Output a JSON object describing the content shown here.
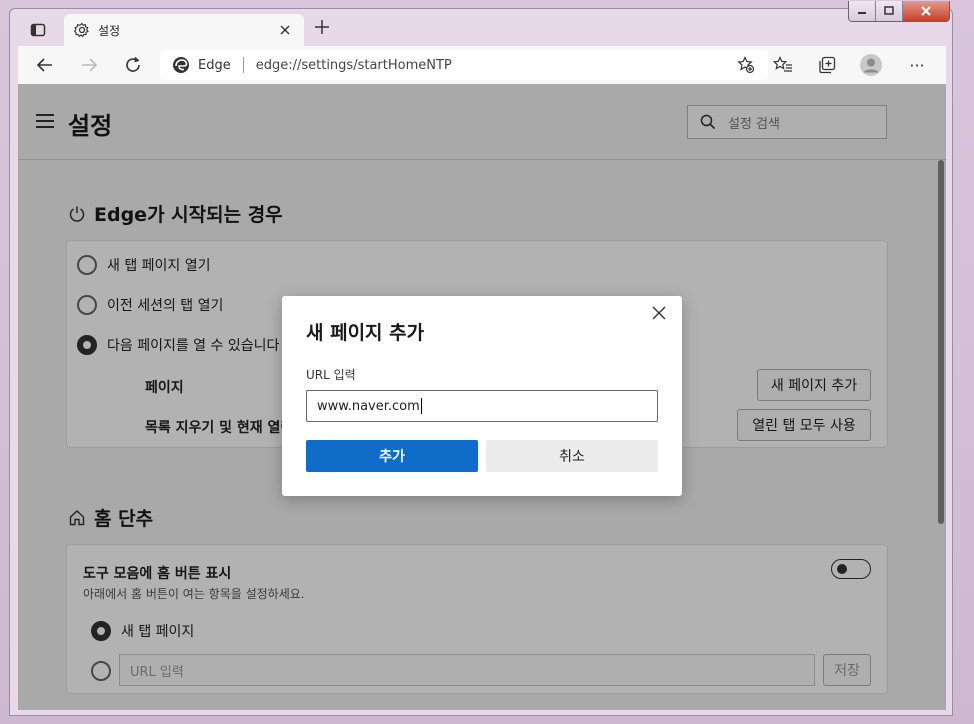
{
  "browser": {
    "tab_title": "설정",
    "address_label": "Edge",
    "address_url": "edge://settings/startHomeNTP",
    "more_label": "···"
  },
  "settings": {
    "title": "설정",
    "search_placeholder": "설정 검색",
    "startup": {
      "title": "Edge가 시작되는 경우",
      "options": [
        {
          "label": "새 탭 페이지 열기",
          "checked": false
        },
        {
          "label": "이전 세션의 탭 열기",
          "checked": false
        },
        {
          "label": "다음 페이지를 열 수 있습니다",
          "checked": true
        }
      ],
      "pages_label": "페이지",
      "add_page_button": "새 페이지 추가",
      "clear_label": "목록 지우기 및 현재 열린 탭으로 설정",
      "use_all_tabs_button": "열린 탭 모두 사용"
    },
    "home": {
      "title": "홈 단추",
      "show_button_label": "도구 모음에 홈 버튼 표시",
      "show_button_desc": "아래에서 홈 버튼이 여는 항목을 설정하세요.",
      "new_tab_option": "새 탭 페이지",
      "url_placeholder": "URL 입력",
      "save_button": "저장",
      "toggle_on": false
    }
  },
  "dialog": {
    "title": "새 페이지 추가",
    "field_label": "URL 입력",
    "field_value": "www.naver.com",
    "add_button": "추가",
    "cancel_button": "취소"
  }
}
